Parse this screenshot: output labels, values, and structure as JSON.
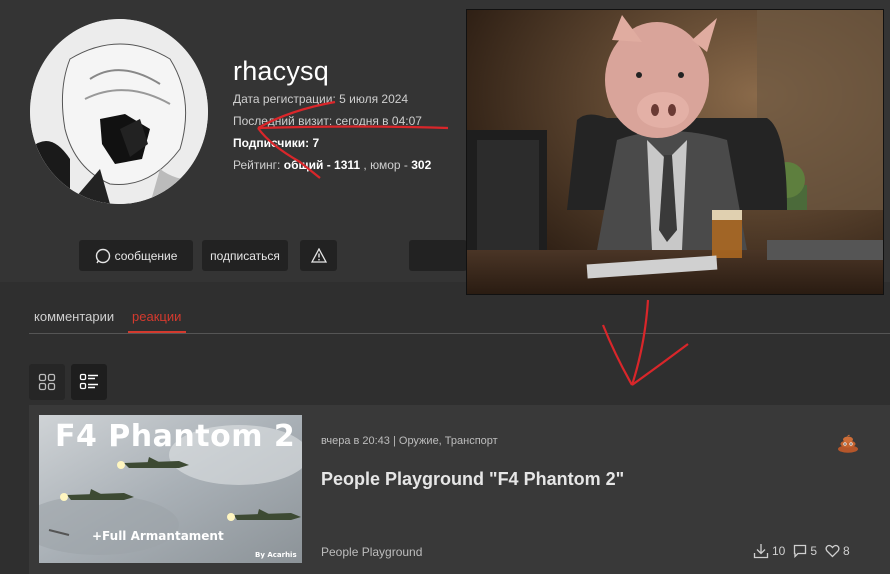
{
  "profile": {
    "username": "rhacysq",
    "registration": "Дата регистрации: 5 июля 2024",
    "last_visit": "Последний визит: сегодня в 04:07",
    "subscribers_label": "Подписчики:",
    "subscribers_count": "7",
    "rating_label": "Рейтинг:",
    "rating_total_label": "общий -",
    "rating_total": "1311",
    "rating_humor_label": ", юмор -",
    "rating_humor": "302"
  },
  "actions": {
    "message": "сообщение",
    "subscribe": "подписаться"
  },
  "tabs": [
    {
      "label": "комментарии"
    },
    {
      "label": "реакции"
    }
  ],
  "post": {
    "thumbnail_title": "F4 Phantom 2",
    "thumbnail_subtitle": "+Full Armantament",
    "thumbnail_credit": "By Acarhis",
    "meta": "вчера в 20:43 | Оружие, Транспорт",
    "title": "People Playground \"F4 Phantom 2\"",
    "category": "People Playground",
    "downloads": "10",
    "comments": "5",
    "likes": "8"
  },
  "icons": [
    "search-icon",
    "warning-icon",
    "grid-view-icon",
    "list-view-icon",
    "poop-icon",
    "download-icon",
    "comment-icon",
    "heart-icon"
  ],
  "colors": {
    "accent": "#d43a2e",
    "background": "#2f2f2f",
    "card": "#393939"
  }
}
